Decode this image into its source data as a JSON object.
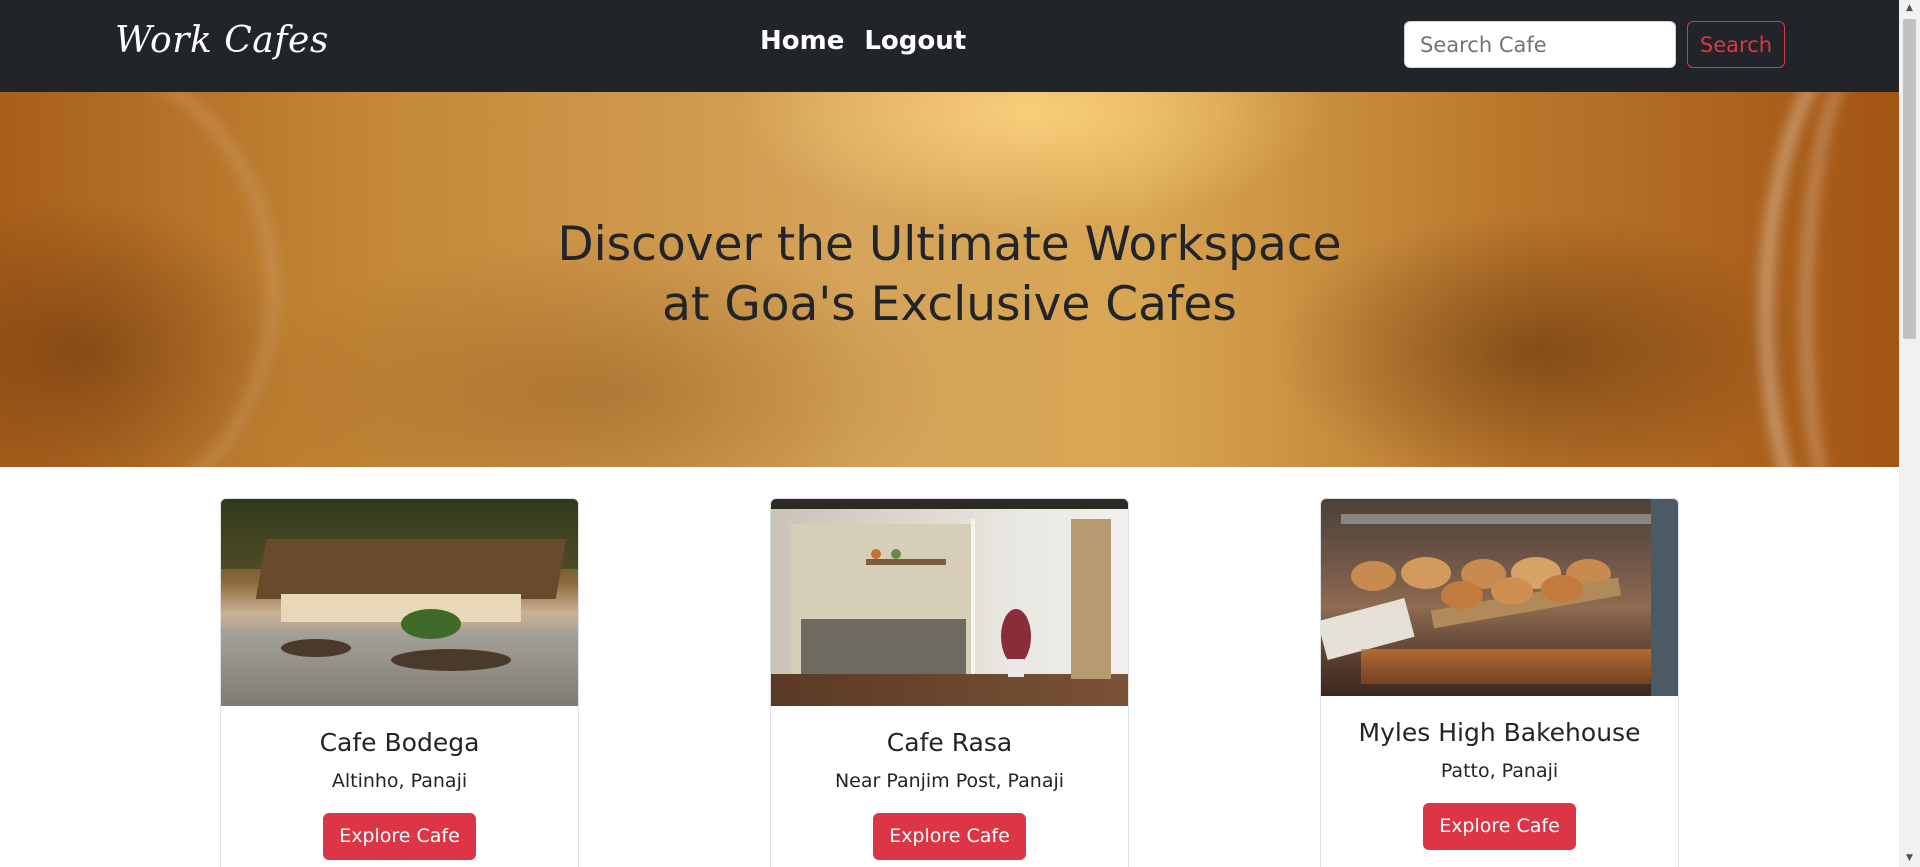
{
  "navbar": {
    "brand": "Work Cafes",
    "links": [
      {
        "label": "Home"
      },
      {
        "label": "Logout"
      }
    ],
    "search": {
      "placeholder": "Search Cafe",
      "value": "",
      "button_label": "Search"
    }
  },
  "hero": {
    "title_line1": "Discover the Ultimate Workspace",
    "title_line2": "at Goa's Exclusive Cafes"
  },
  "cafes": [
    {
      "name": "Cafe Bodega",
      "location": "Altinho, Panaji",
      "button_label": "Explore Cafe"
    },
    {
      "name": "Cafe Rasa",
      "location": "Near Panjim Post, Panaji",
      "button_label": "Explore Cafe"
    },
    {
      "name": "Myles High Bakehouse",
      "location": "Patto, Panaji",
      "button_label": "Explore Cafe"
    }
  ],
  "colors": {
    "navbar_bg": "#212529",
    "accent": "#dc3545",
    "text": "#212529"
  },
  "icons": {
    "scroll_up": "scroll-up-arrow-icon",
    "scroll_down": "scroll-down-arrow-icon"
  }
}
